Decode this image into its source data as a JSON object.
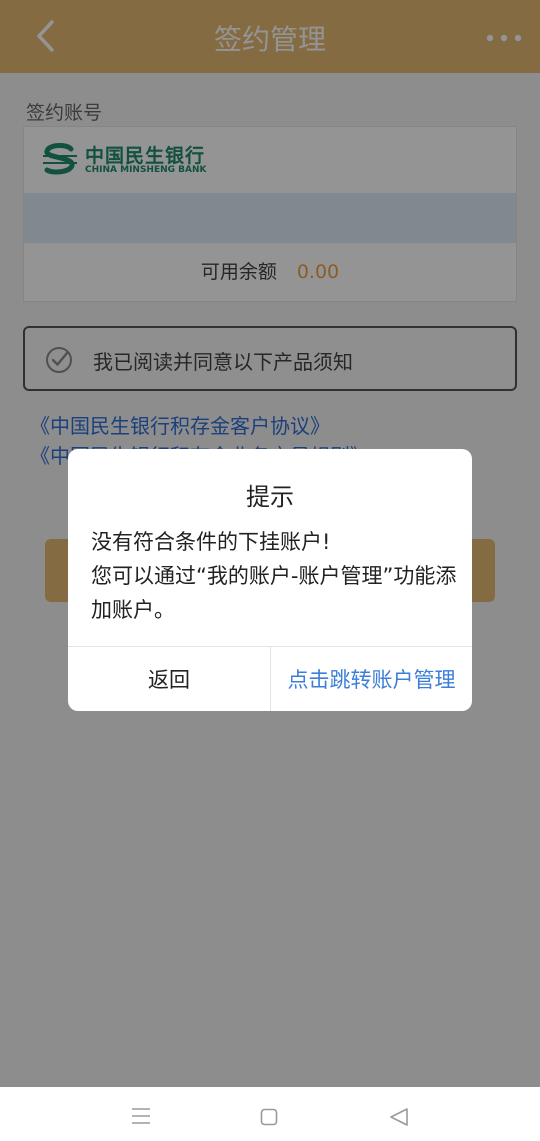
{
  "header": {
    "title": "签约管理"
  },
  "account_section": {
    "label": "签约账号",
    "bank_name_cn": "中国民生银行",
    "bank_name_en": "CHINA MINSHENG BANK",
    "balance_label": "可用余额",
    "balance_value": "0.00"
  },
  "agreement": {
    "text": "我已阅读并同意以下产品须知",
    "link1": "《中国民生银行积存金客户协议》",
    "link2": "《中国民生银行积存金业务交易规则》"
  },
  "dialog": {
    "title": "提示",
    "message_line1": "没有符合条件的下挂账户!",
    "message_line2": "您可以通过“我的账户-账户管理”功能添加账户。",
    "back_label": "返回",
    "jump_label": "点击跳转账户管理"
  },
  "colors": {
    "accent": "#e3b970",
    "link": "#2f6fd6",
    "amount": "#f0a142"
  },
  "icons": {
    "back": "chevron-left-icon",
    "more": "more-dots-icon",
    "check": "check-circle-icon"
  }
}
